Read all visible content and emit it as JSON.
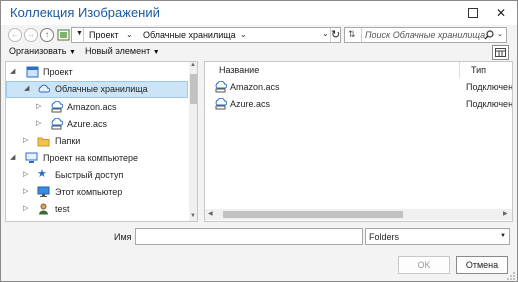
{
  "window": {
    "title": "Коллекция Изображений",
    "close_glyph": "✕"
  },
  "address_bar": {
    "crumbs": [
      "Проект",
      "Облачные хранилища"
    ],
    "refresh_glyph": "↻",
    "search_placeholder": "Поиск Облачные хранилища"
  },
  "toolbar": {
    "organize_label": "Организовать",
    "new_item_label": "Новый элемент"
  },
  "tree": {
    "items": [
      {
        "label": "Проект",
        "icon": "project-icon"
      },
      {
        "label": "Облачные хранилища",
        "icon": "cloud-storage-icon"
      },
      {
        "label": "Amazon.acs",
        "icon": "cloud-connection-icon"
      },
      {
        "label": "Azure.acs",
        "icon": "cloud-connection-icon"
      },
      {
        "label": "Папки",
        "icon": "folder-icon"
      },
      {
        "label": "Проект на компьютере",
        "icon": "computer-project-icon"
      },
      {
        "label": "Быстрый доступ",
        "icon": "star-icon"
      },
      {
        "label": "Этот компьютер",
        "icon": "monitor-icon"
      },
      {
        "label": "test",
        "icon": "user-icon"
      }
    ]
  },
  "list": {
    "columns": [
      "Название",
      "Тип"
    ],
    "rows": [
      {
        "name": "Amazon.acs",
        "type": "Подключение"
      },
      {
        "name": "Azure.acs",
        "type": "Подключение"
      }
    ]
  },
  "footer": {
    "name_label": "Имя",
    "name_value": "",
    "type_value": "Folders",
    "ok_label": "OK",
    "cancel_label": "Отмена"
  },
  "colors": {
    "title": "#1a5aa0",
    "selection": "#cce4f7",
    "icon_blue": "#2a6fc4"
  }
}
